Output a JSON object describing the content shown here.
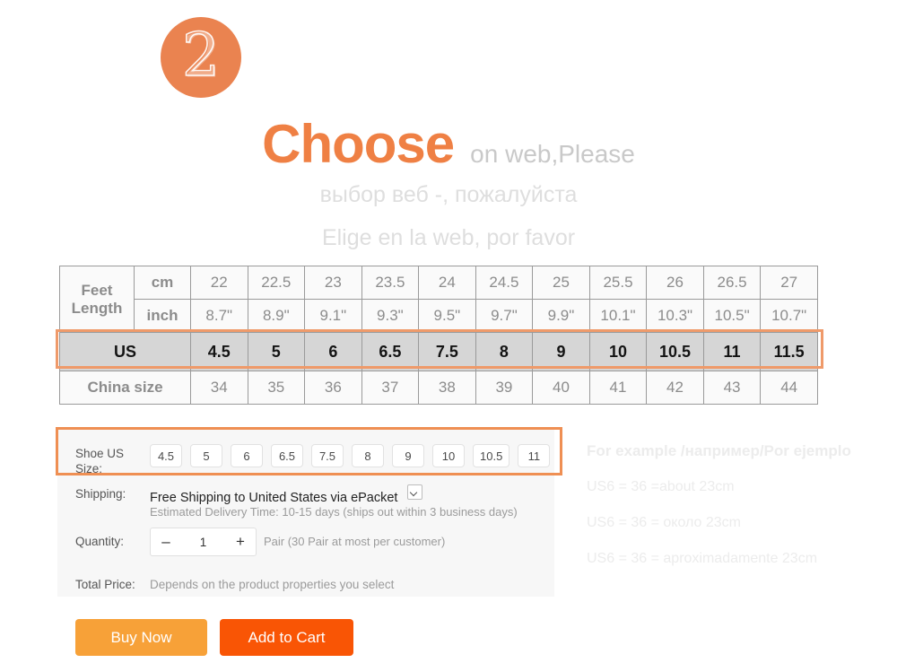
{
  "header": {
    "step_number": "2",
    "heading_main": "Choose",
    "heading_sub": "on web,Please",
    "subline_ru": "выбор веб -, пожалуйста",
    "subline_es": "Elige en la web, por favor"
  },
  "size_table": {
    "feet_length_label": "Feet Length",
    "cm_label": "cm",
    "inch_label": "inch",
    "us_label": "US",
    "china_label": "China size",
    "cm": [
      "22",
      "22.5",
      "23",
      "23.5",
      "24",
      "24.5",
      "25",
      "25.5",
      "26",
      "26.5",
      "27"
    ],
    "inch": [
      "8.7\"",
      "8.9\"",
      "9.1\"",
      "9.3\"",
      "9.5\"",
      "9.7\"",
      "9.9\"",
      "10.1\"",
      "10.3\"",
      "10.5\"",
      "10.7\""
    ],
    "us": [
      "4.5",
      "5",
      "6",
      "6.5",
      "7.5",
      "8",
      "9",
      "10",
      "10.5",
      "11",
      "11.5"
    ],
    "china": [
      "34",
      "35",
      "36",
      "37",
      "38",
      "39",
      "40",
      "41",
      "42",
      "43",
      "44"
    ]
  },
  "purchase": {
    "size_label": "Shoe US Size:",
    "size_options": [
      "4.5",
      "5",
      "6",
      "6.5",
      "7.5",
      "8",
      "9",
      "10",
      "10.5",
      "11"
    ],
    "shipping_label": "Shipping:",
    "shipping_value": "Free Shipping to United States via ePacket",
    "delivery_note": "Estimated Delivery Time: 10-15 days (ships out within 3  business days)",
    "quantity_label": "Quantity:",
    "quantity_minus": "–",
    "quantity_value": "1",
    "quantity_plus": "+",
    "quantity_note": "Pair (30 Pair at most per customer)",
    "total_label": "Total Price:",
    "total_value": "Depends on the product properties you select"
  },
  "example": {
    "title": "For example /например/Por ejemplo",
    "lines": [
      "US6 = 36 =about 23cm",
      "US6 = 36 = около 23cm",
      "US6 = 36 = aproximadamente 23cm"
    ]
  },
  "actions": {
    "buy_now": "Buy Now",
    "add_to_cart": "Add to Cart"
  },
  "colors": {
    "accent_orange": "#ef8044",
    "badge_orange": "#ea8350",
    "highlight_border": "#ef9a6a",
    "buy_now_bg": "#f7a138",
    "add_to_cart_bg": "#f95505"
  }
}
